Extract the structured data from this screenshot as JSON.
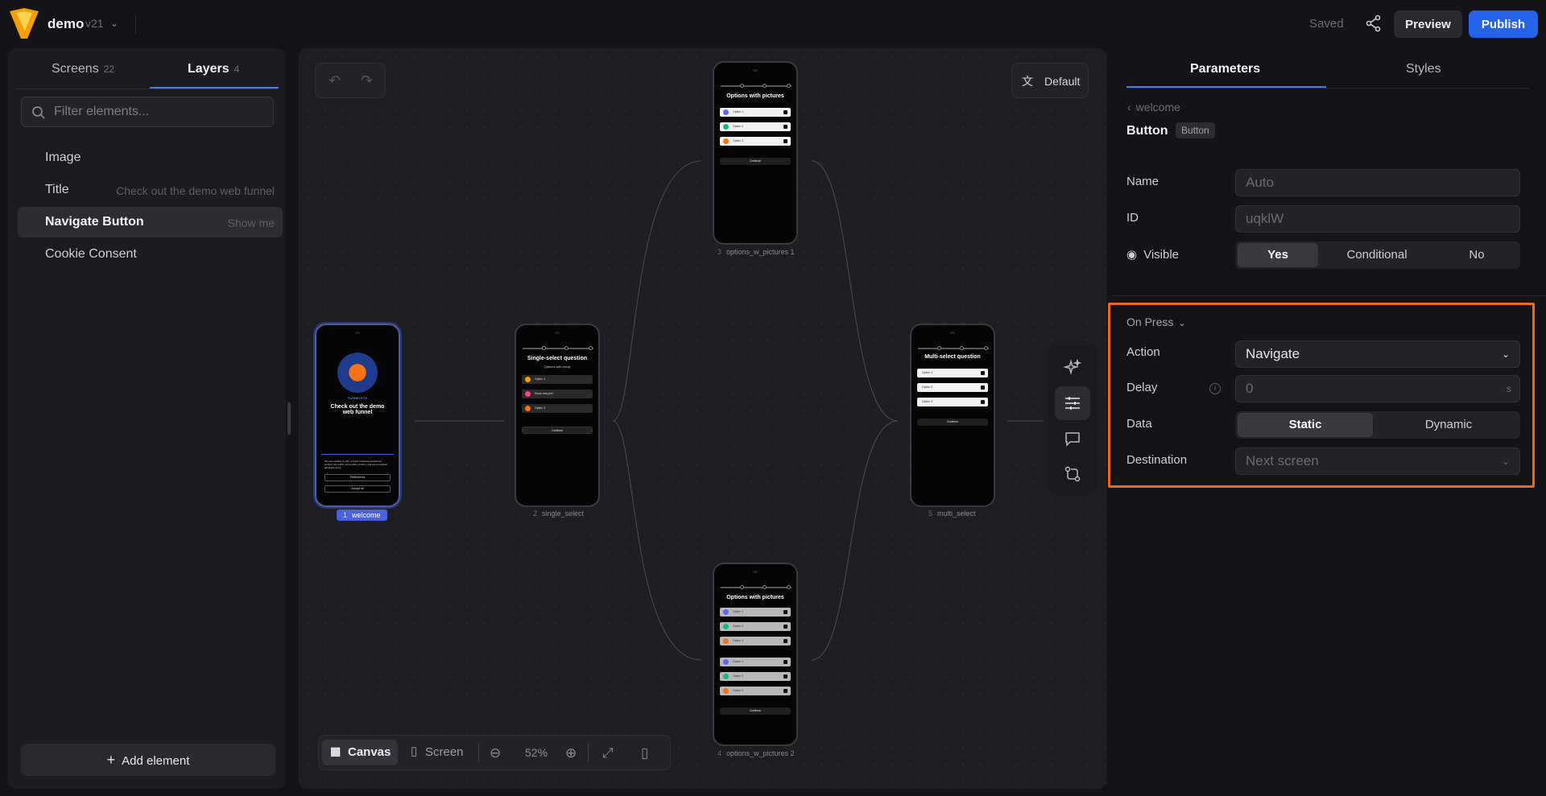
{
  "topbar": {
    "project_name": "demo",
    "version": "v21",
    "status": "Saved",
    "preview_label": "Preview",
    "publish_label": "Publish"
  },
  "left_panel": {
    "tabs": [
      {
        "label": "Screens",
        "count": "22"
      },
      {
        "label": "Layers",
        "count": "4"
      }
    ],
    "active_tab": "Layers",
    "filter_placeholder": "Filter elements...",
    "layers": [
      {
        "name": "Image",
        "sub": ""
      },
      {
        "name": "Title",
        "sub": "Check out the demo web funnel"
      },
      {
        "name": "Navigate Button",
        "sub": "Show me"
      },
      {
        "name": "Cookie Consent",
        "sub": ""
      }
    ],
    "selected_layer": "Navigate Button",
    "add_element_label": "Add element"
  },
  "canvas": {
    "language_label": "Default",
    "screens": [
      {
        "index": "1",
        "name": "welcome",
        "title": "Check out the demo web funnel",
        "brand": "FUNNELFOX",
        "selected": true
      },
      {
        "index": "2",
        "name": "single_select",
        "title": "Single-select question",
        "subtitle": "Options with emoji",
        "options": [
          "Option 1",
          "Show one pref",
          "Option 3"
        ],
        "button": "Continue"
      },
      {
        "index": "3",
        "name": "options_w_pictures 1",
        "title": "Options with pictures",
        "options": [
          "Option 1",
          "Option 2",
          "Option 3"
        ],
        "button": "Continue"
      },
      {
        "index": "4",
        "name": "options_w_pictures 2",
        "title": "Options with pictures",
        "options": [
          "Option 1",
          "Option 2",
          "Option 3",
          "Option 1",
          "Option 2",
          "Option 3"
        ],
        "button": "Continue"
      },
      {
        "index": "5",
        "name": "multi_select",
        "title": "Multi-select question",
        "options": [
          "Option 1",
          "Option 2",
          "Option 3"
        ],
        "button": "Continue"
      }
    ],
    "welcome_cookie": {
      "text": "We use cookies to offer a better browsing experience, analyze site traffic, personalize content, and serve targeted advertisements.",
      "preferences": "Preferences",
      "accept": "Accept all"
    },
    "view_modes": [
      "Canvas",
      "Screen"
    ],
    "active_view": "Canvas",
    "zoom": "52%"
  },
  "right_panel": {
    "tabs": [
      "Parameters",
      "Styles"
    ],
    "active_tab": "Parameters",
    "breadcrumb": "welcome",
    "element_title": "Button",
    "element_type": "Button",
    "name_label": "Name",
    "name_value": "Auto",
    "id_label": "ID",
    "id_value": "uqklW",
    "visible_label": "Visible",
    "visible_options": [
      "Yes",
      "Conditional",
      "No"
    ],
    "visible_selected": "Yes",
    "on_press_label": "On Press",
    "action_label": "Action",
    "action_value": "Navigate",
    "delay_label": "Delay",
    "delay_value": "0",
    "delay_unit": "s",
    "data_label": "Data",
    "data_options": [
      "Static",
      "Dynamic"
    ],
    "data_selected": "Static",
    "destination_label": "Destination",
    "destination_placeholder": "Next screen"
  },
  "colors": {
    "accent": "#2563eb",
    "highlight": "#ea6a1c",
    "selected_screen": "#4a62e0"
  }
}
